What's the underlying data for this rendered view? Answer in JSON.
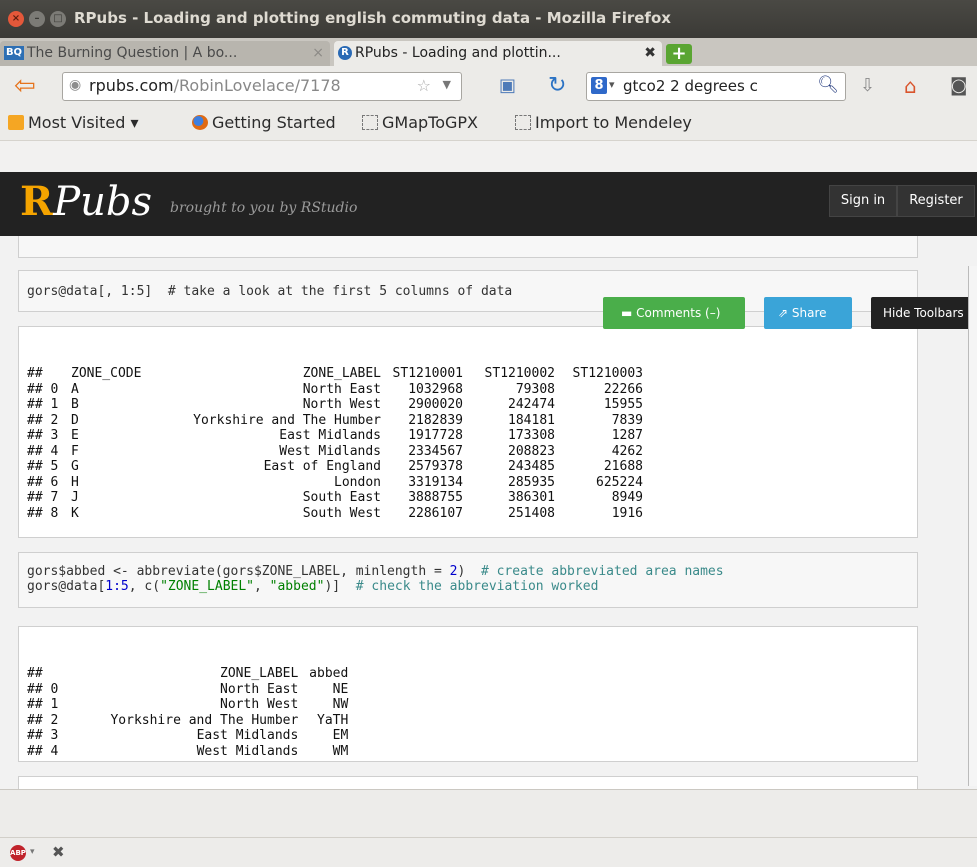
{
  "window": {
    "title": "RPubs - Loading and plotting english commuting data - Mozilla Firefox",
    "btn_close": "×",
    "btn_min": "–",
    "btn_max": "□"
  },
  "tabs": [
    {
      "label": "The Burning Question | A bo...",
      "icon": "BQ",
      "close": "×"
    },
    {
      "label": "RPubs - Loading and plottin...",
      "icon": "R",
      "close": "✖"
    }
  ],
  "newtab": "+",
  "nav": {
    "url_host": "rpubs.com",
    "url_path": "/RobinLovelace/7178",
    "search_engine": "8",
    "search_value": "gtco2 2 degrees c",
    "search_drop": "▾"
  },
  "bookmarks": [
    {
      "label": "Most Visited ▾"
    },
    {
      "label": "Getting Started"
    },
    {
      "label": "GMapToGPX"
    },
    {
      "label": "Import to Mendeley"
    }
  ],
  "rpubs": {
    "logo_r": "R",
    "logo_rest": "Pubs",
    "tagline": "brought to you by RStudio",
    "signin": "Sign in",
    "register": "Register"
  },
  "toolbar": {
    "comments": "Comments (–)",
    "share": "Share",
    "hide": "Hide Toolbars"
  },
  "code1": {
    "line": "gors@data[, 1:5]  # take a look at the first 5 columns of data"
  },
  "table1": {
    "headers": [
      "##",
      "ZONE_CODE",
      "ZONE_LABEL",
      "ST1210001",
      "ST1210002",
      "ST1210003"
    ],
    "rows": [
      [
        "## 0",
        "A",
        "North East",
        "1032968",
        "79308",
        "22266"
      ],
      [
        "## 1",
        "B",
        "North West",
        "2900020",
        "242474",
        "15955"
      ],
      [
        "## 2",
        "D",
        "Yorkshire and The Humber",
        "2182839",
        "184181",
        "7839"
      ],
      [
        "## 3",
        "E",
        "East Midlands",
        "1917728",
        "173308",
        "1287"
      ],
      [
        "## 4",
        "F",
        "West Midlands",
        "2334567",
        "208823",
        "4262"
      ],
      [
        "## 5",
        "G",
        "East of England",
        "2579378",
        "243485",
        "21688"
      ],
      [
        "## 6",
        "H",
        "London",
        "3319134",
        "285935",
        "625224"
      ],
      [
        "## 7",
        "J",
        "South East",
        "3888755",
        "386301",
        "8949"
      ],
      [
        "## 8",
        "K",
        "South West",
        "2286107",
        "251408",
        "1916"
      ]
    ]
  },
  "code2": {
    "line1_a": "gors$abbed <- abbreviate(gors$ZONE_LABEL, minlength = ",
    "line1_num": "2",
    "line1_b": ")  ",
    "line1_cmt": "# create abbreviated area names",
    "line2_a": "gors@data[",
    "line2_num": "1:5",
    "line2_b": ", c(",
    "line2_s1": "\"ZONE_LABEL\"",
    "line2_c": ", ",
    "line2_s2": "\"abbed\"",
    "line2_d": ")]  ",
    "line2_cmt": "# check the abbreviation worked"
  },
  "table2": {
    "headers": [
      "##",
      "ZONE_LABEL",
      "abbed"
    ],
    "rows": [
      [
        "## 0",
        "North East",
        "NE"
      ],
      [
        "## 1",
        "North West",
        "NW"
      ],
      [
        "## 2",
        "Yorkshire and The Humber",
        "YaTH"
      ],
      [
        "## 3",
        "East Midlands",
        "EM"
      ],
      [
        "## 4",
        "West Midlands",
        "WM"
      ]
    ]
  },
  "addon": {
    "abp": "ABP",
    "drop": "▾",
    "close": "✖"
  }
}
